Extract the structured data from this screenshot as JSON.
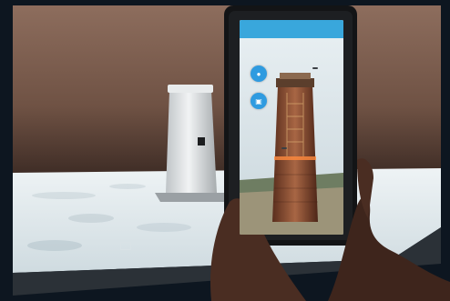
{
  "app": {
    "header_title": "",
    "distance_badge": "",
    "info_label": "",
    "brand_text": ""
  },
  "icons": {
    "left_button_top": "camera-icon",
    "left_button_bottom": "layers-icon"
  },
  "colors": {
    "app_header": "#39a7dc",
    "fab": "#2f9be0",
    "table_surface": "#e6edf0",
    "wall": "#7d5d4e"
  }
}
